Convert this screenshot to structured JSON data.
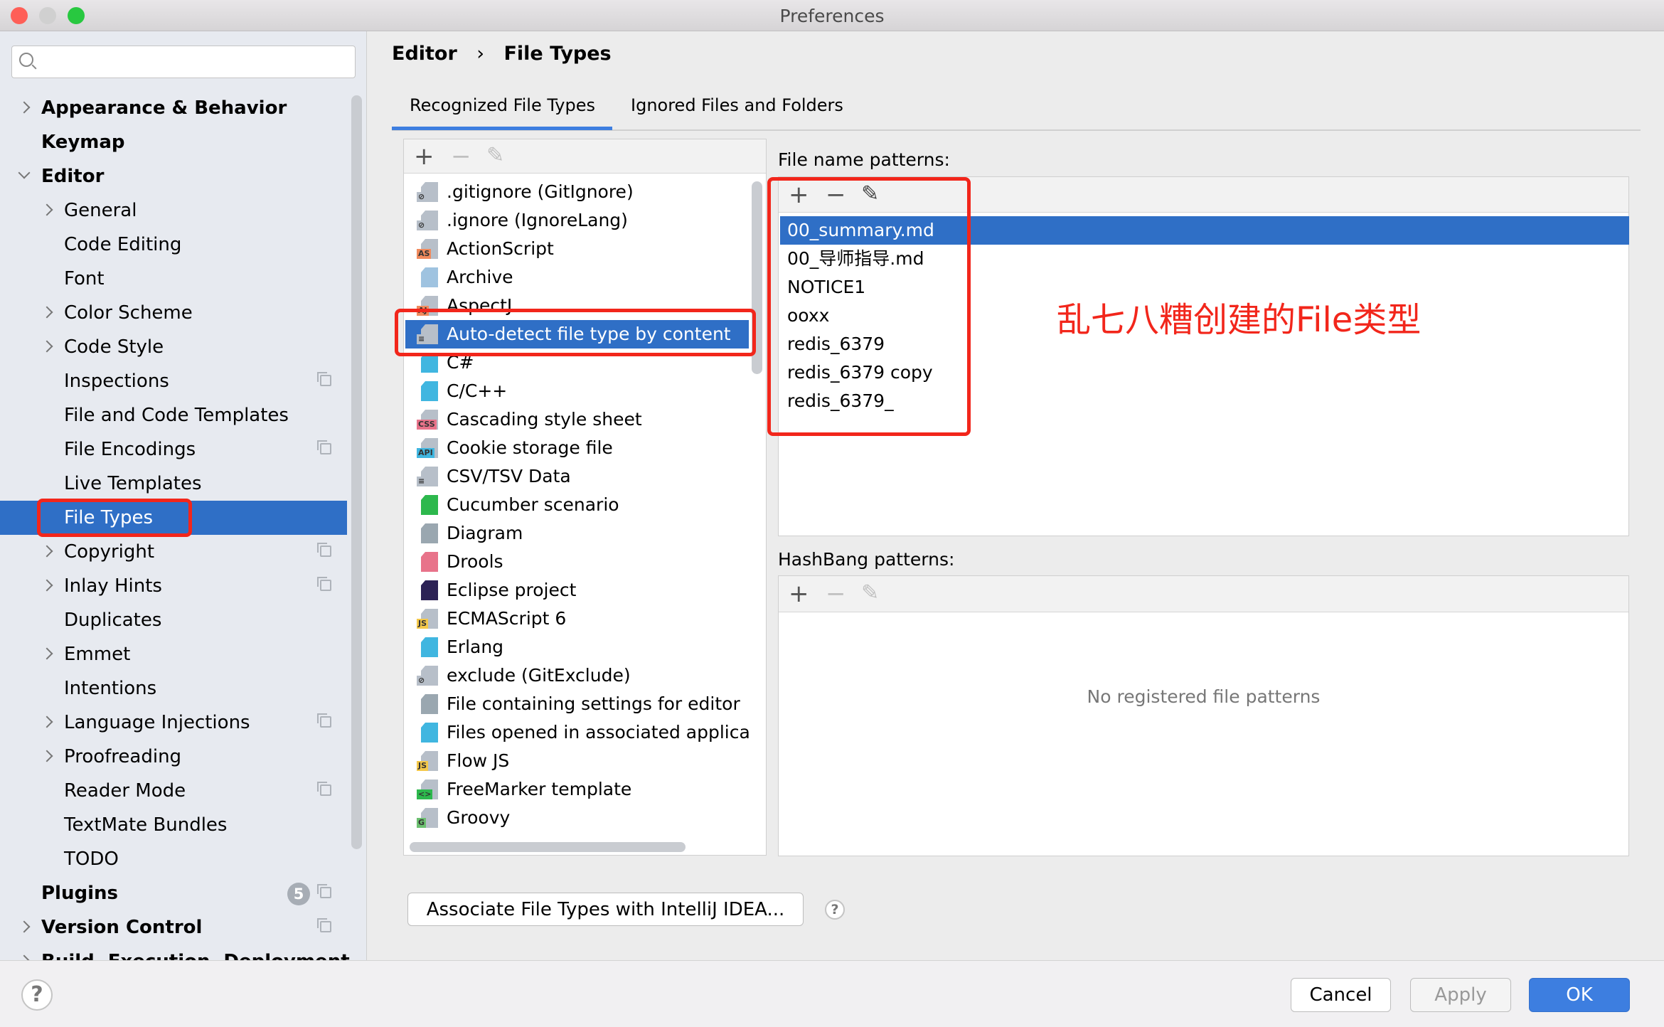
{
  "window": {
    "title": "Preferences",
    "traffic_lights": [
      "#fe5f57",
      "#d0d0d0",
      "#28c840"
    ]
  },
  "sidebar": {
    "search_placeholder": "",
    "items": [
      {
        "label": "Appearance & Behavior",
        "level": 0,
        "chevron": "right",
        "bold": true
      },
      {
        "label": "Keymap",
        "level": 0,
        "chevron": "",
        "bold": true
      },
      {
        "label": "Editor",
        "level": 0,
        "chevron": "down",
        "bold": true
      },
      {
        "label": "General",
        "level": 1,
        "chevron": "right"
      },
      {
        "label": "Code Editing",
        "level": 1,
        "chevron": ""
      },
      {
        "label": "Font",
        "level": 1,
        "chevron": ""
      },
      {
        "label": "Color Scheme",
        "level": 1,
        "chevron": "right"
      },
      {
        "label": "Code Style",
        "level": 1,
        "chevron": "right"
      },
      {
        "label": "Inspections",
        "level": 1,
        "chevron": "",
        "copy": true
      },
      {
        "label": "File and Code Templates",
        "level": 1,
        "chevron": ""
      },
      {
        "label": "File Encodings",
        "level": 1,
        "chevron": "",
        "copy": true
      },
      {
        "label": "Live Templates",
        "level": 1,
        "chevron": ""
      },
      {
        "label": "File Types",
        "level": 1,
        "chevron": "",
        "selected": true
      },
      {
        "label": "Copyright",
        "level": 1,
        "chevron": "right",
        "copy": true
      },
      {
        "label": "Inlay Hints",
        "level": 1,
        "chevron": "right",
        "copy": true
      },
      {
        "label": "Duplicates",
        "level": 1,
        "chevron": ""
      },
      {
        "label": "Emmet",
        "level": 1,
        "chevron": "right"
      },
      {
        "label": "Intentions",
        "level": 1,
        "chevron": ""
      },
      {
        "label": "Language Injections",
        "level": 1,
        "chevron": "right",
        "copy": true
      },
      {
        "label": "Proofreading",
        "level": 1,
        "chevron": "right"
      },
      {
        "label": "Reader Mode",
        "level": 1,
        "chevron": "",
        "copy": true
      },
      {
        "label": "TextMate Bundles",
        "level": 1,
        "chevron": ""
      },
      {
        "label": "TODO",
        "level": 1,
        "chevron": ""
      },
      {
        "label": "Plugins",
        "level": 0,
        "chevron": "",
        "bold": true,
        "badge": "5",
        "copy": true
      },
      {
        "label": "Version Control",
        "level": 0,
        "chevron": "right",
        "bold": true,
        "copy": true
      },
      {
        "label": "Build, Execution, Deployment",
        "level": 0,
        "chevron": "right",
        "bold": true
      }
    ]
  },
  "breadcrumb": {
    "parent": "Editor",
    "separator": "›",
    "current": "File Types"
  },
  "tabs": [
    {
      "label": "Recognized File Types",
      "active": true
    },
    {
      "label": "Ignored Files and Folders",
      "active": false
    }
  ],
  "file_types": {
    "toolbar": {
      "add": "+",
      "remove": "−",
      "edit": "✎"
    },
    "items": [
      {
        "label": ".gitignore (GitIgnore)",
        "icon": "gitignore-icon",
        "badge": "⊘",
        "color": "#b7bfc9"
      },
      {
        "label": ".ignore (IgnoreLang)",
        "icon": "ignore-icon",
        "badge": "⊘",
        "color": "#b7bfc9"
      },
      {
        "label": "ActionScript",
        "icon": "actionscript-icon",
        "badge": "AS",
        "color": "#f08a5d"
      },
      {
        "label": "Archive",
        "icon": "archive-icon",
        "badge": "",
        "color": "#9fc3e0"
      },
      {
        "label": "AspectJ",
        "icon": "aspectj-icon",
        "badge": "AJ",
        "color": "#f08a5d"
      },
      {
        "label": "Auto-detect file type by content",
        "icon": "text-file-icon",
        "badge": "≡",
        "color": "#b7bfc9",
        "selected": true
      },
      {
        "label": "C#",
        "icon": "csharp-icon",
        "badge": "",
        "color": "#40b6e0"
      },
      {
        "label": "C/C++",
        "icon": "cpp-icon",
        "badge": "",
        "color": "#40b6e0"
      },
      {
        "label": "Cascading style sheet",
        "icon": "css-icon",
        "badge": "CSS",
        "color": "#e8738a"
      },
      {
        "label": "Cookie storage file",
        "icon": "api-icon",
        "badge": "API",
        "color": "#40b6e0"
      },
      {
        "label": "CSV/TSV Data",
        "icon": "csv-icon",
        "badge": "≡",
        "color": "#b7bfc9"
      },
      {
        "label": "Cucumber scenario",
        "icon": "cucumber-icon",
        "badge": "",
        "color": "#2db84d"
      },
      {
        "label": "Diagram",
        "icon": "diagram-icon",
        "badge": "",
        "color": "#9aa7b0"
      },
      {
        "label": "Drools",
        "icon": "drools-icon",
        "badge": "",
        "color": "#e8738a"
      },
      {
        "label": "Eclipse project",
        "icon": "eclipse-icon",
        "badge": "",
        "color": "#2c2255"
      },
      {
        "label": "ECMAScript 6",
        "icon": "js-icon",
        "badge": "JS",
        "color": "#f4c84a"
      },
      {
        "label": "Erlang",
        "icon": "erlang-icon",
        "badge": "",
        "color": "#40b6e0"
      },
      {
        "label": "exclude (GitExclude)",
        "icon": "gitexclude-icon",
        "badge": "⊘",
        "color": "#b7bfc9"
      },
      {
        "label": "File containing settings for editor",
        "icon": "gear-icon",
        "badge": "",
        "color": "#9aa7b0"
      },
      {
        "label": "Files opened in associated applications",
        "icon": "external-file-icon",
        "badge": "",
        "color": "#40b6e0"
      },
      {
        "label": "Flow JS",
        "icon": "flow-js-icon",
        "badge": "JS",
        "color": "#f4c84a"
      },
      {
        "label": "FreeMarker template",
        "icon": "freemarker-icon",
        "badge": "<>",
        "color": "#2db84d"
      },
      {
        "label": "Groovy",
        "icon": "groovy-icon",
        "badge": "G",
        "color": "#6cc070"
      }
    ]
  },
  "file_name_patterns": {
    "label": "File name patterns:",
    "toolbar": {
      "add": "+",
      "remove": "−",
      "edit": "✎"
    },
    "items": [
      {
        "label": "00_summary.md",
        "selected": true
      },
      {
        "label": "00_导师指导.md"
      },
      {
        "label": "NOTICE1"
      },
      {
        "label": "ooxx"
      },
      {
        "label": "redis_6379"
      },
      {
        "label": "redis_6379 copy"
      },
      {
        "label": "redis_6379_"
      }
    ]
  },
  "annotation": {
    "text": "乱七八糟创建的File类型",
    "color": "#f2261b"
  },
  "hashbang": {
    "label": "HashBang patterns:",
    "toolbar": {
      "add": "+",
      "remove": "−",
      "edit": "✎"
    },
    "empty_text": "No registered file patterns"
  },
  "associate_button": "Associate File Types with IntelliJ IDEA...",
  "help": "?",
  "footer": {
    "cancel": "Cancel",
    "apply": "Apply",
    "ok": "OK",
    "accent": "#3d7ee0"
  }
}
